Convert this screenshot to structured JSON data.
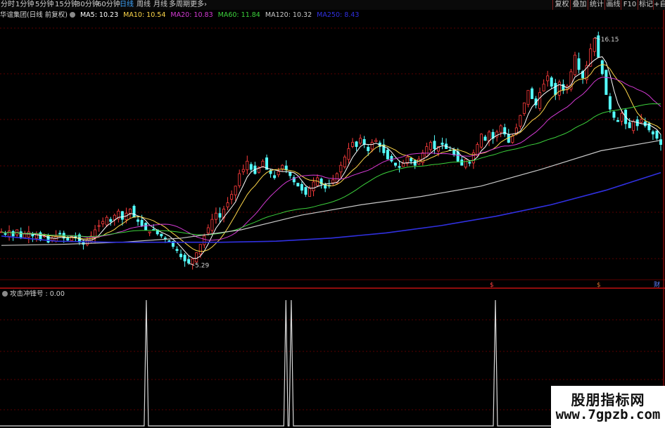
{
  "toolbar": {
    "period_tabs": [
      {
        "label": "分时",
        "active": false
      },
      {
        "label": "1分钟",
        "active": false
      },
      {
        "label": "5分钟",
        "active": false
      },
      {
        "label": "15分钟",
        "active": false
      },
      {
        "label": "30分钟",
        "active": false
      },
      {
        "label": "60分钟",
        "active": false
      },
      {
        "label": "日线",
        "active": true
      },
      {
        "label": "周线",
        "active": false
      },
      {
        "label": "月线",
        "active": false
      },
      {
        "label": "多周期",
        "active": false
      },
      {
        "label": "更多",
        "active": false
      }
    ],
    "more_arrow": "›",
    "right_buttons": [
      "复权",
      "叠加",
      "统计",
      "画线",
      "F10",
      "标记",
      "+自"
    ]
  },
  "chart_header": {
    "stock_label": "华谊集团(日线 前复权)",
    "ma": [
      {
        "label": "MA5: 10.23",
        "color": "#ffffff"
      },
      {
        "label": "MA10: 10.54",
        "color": "#ffd84a"
      },
      {
        "label": "MA20: 10.83",
        "color": "#d33ad3"
      },
      {
        "label": "MA60: 11.84",
        "color": "#3cd23c"
      },
      {
        "label": "MA120: 10.32",
        "color": "#c8c8c8"
      },
      {
        "label": "MA250: 8.43",
        "color": "#3030e0"
      }
    ]
  },
  "annotations": {
    "high": "16.15",
    "low": "5.29"
  },
  "markers": [
    "$",
    "$",
    "财"
  ],
  "marker_colors": [
    "#ff4040",
    "#d07030",
    "#6080ff"
  ],
  "indicator_label": "攻击冲锋号 : 0.00",
  "watermark": {
    "text": "股朋指标网",
    "url": "www.7gpzb.com"
  },
  "colors": {
    "up": "#ff3c3c",
    "down": "#54ffff",
    "grid": "#5a0000",
    "separator": "#c01010",
    "signal": "#d8d8d8"
  },
  "chart_data": {
    "type": "candlestick",
    "price_range": [
      4.5,
      17.0
    ],
    "high": 16.15,
    "low": 5.29,
    "close_path": [
      6.8,
      6.7,
      6.85,
      6.6,
      6.9,
      6.5,
      6.7,
      6.8,
      6.6,
      6.7,
      6.4,
      6.6,
      6.3,
      6.5,
      6.6,
      6.7,
      6.5,
      6.4,
      6.6,
      6.5,
      6.3,
      6.2,
      6.4,
      6.6,
      6.9,
      7.1,
      7.3,
      7.5,
      7.3,
      7.6,
      7.8,
      7.4,
      7.7,
      7.9,
      7.5,
      7.3,
      7.1,
      6.9,
      6.8,
      6.9,
      6.7,
      6.6,
      6.5,
      6.3,
      6.1,
      5.9,
      5.6,
      5.4,
      5.3,
      5.5,
      5.8,
      6.2,
      6.6,
      7.0,
      7.4,
      7.7,
      7.5,
      7.9,
      8.2,
      8.6,
      9.0,
      9.6,
      9.8,
      10.2,
      9.8,
      9.6,
      9.9,
      10.2,
      9.8,
      9.6,
      9.4,
      9.7,
      10.0,
      9.8,
      9.5,
      9.2,
      9.0,
      8.8,
      8.6,
      8.9,
      9.2,
      9.4,
      9.1,
      8.9,
      9.0,
      9.3,
      9.6,
      10.0,
      10.4,
      10.8,
      11.1,
      10.9,
      11.3,
      11.0,
      10.7,
      11.1,
      11.2,
      10.9,
      10.6,
      10.3,
      10.2,
      10.0,
      9.9,
      10.1,
      10.4,
      10.2,
      10.0,
      10.3,
      10.6,
      10.9,
      11.1,
      10.8,
      10.9,
      11.0,
      10.8,
      10.7,
      10.5,
      10.2,
      10.0,
      10.3,
      10.1,
      10.6,
      11.0,
      11.5,
      11.2,
      11.6,
      11.3,
      11.6,
      11.9,
      11.5,
      11.1,
      11.4,
      11.8,
      12.4,
      13.0,
      13.6,
      13.2,
      12.9,
      13.5,
      13.9,
      14.3,
      13.8,
      13.4,
      14.0,
      13.6,
      13.8,
      14.5,
      15.3,
      14.6,
      14.2,
      14.8,
      15.6,
      16.1,
      15.2,
      14.4,
      13.4,
      12.7,
      12.3,
      12.1,
      12.5,
      12.0,
      11.8,
      12.1,
      11.9,
      12.2,
      11.9,
      11.7,
      11.5,
      11.3,
      11.0
    ],
    "ma250": [
      [
        0,
        6.6
      ],
      [
        1,
        6.35
      ],
      [
        2,
        6.3
      ],
      [
        3,
        6.3
      ],
      [
        4,
        6.3
      ],
      [
        5,
        6.35
      ],
      [
        6,
        6.5
      ],
      [
        7,
        6.75
      ],
      [
        8,
        7.1
      ],
      [
        9,
        7.55
      ],
      [
        10,
        8.1
      ],
      [
        11,
        8.8
      ],
      [
        12,
        9.65
      ]
    ],
    "ma120": [
      [
        0,
        6.15
      ],
      [
        1,
        6.2
      ],
      [
        2,
        6.3
      ],
      [
        3,
        6.5
      ],
      [
        4,
        6.9
      ],
      [
        5,
        7.6
      ],
      [
        6,
        8.1
      ],
      [
        7,
        8.5
      ],
      [
        8,
        9.0
      ],
      [
        9,
        9.8
      ],
      [
        10,
        10.7
      ],
      [
        11,
        11.2
      ]
    ],
    "signal_spikes": [
      0.22,
      0.43,
      0.438,
      0.745
    ]
  }
}
